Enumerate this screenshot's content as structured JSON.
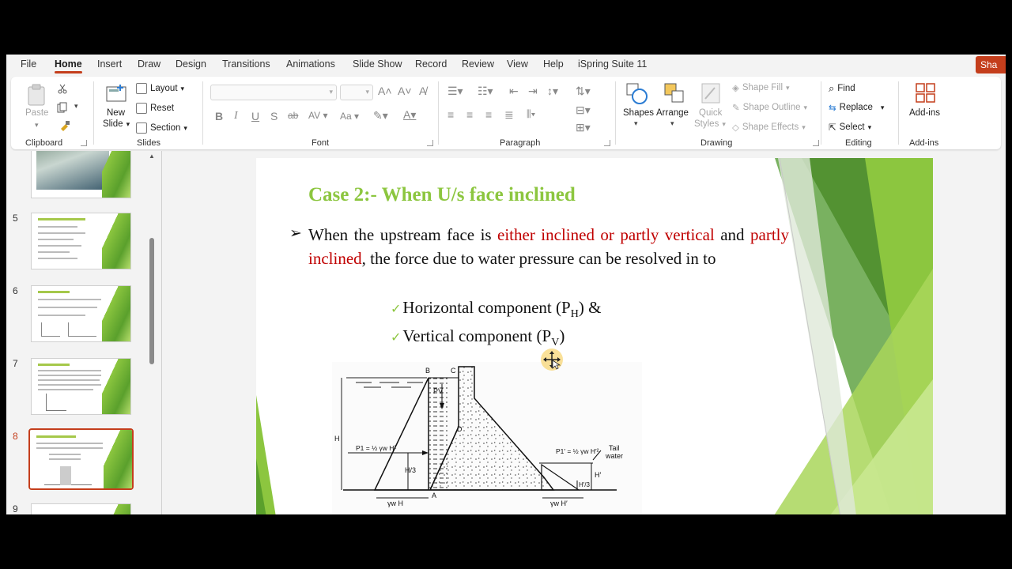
{
  "menu": {
    "tabs": [
      "File",
      "Home",
      "Insert",
      "Draw",
      "Design",
      "Transitions",
      "Animations",
      "Slide Show",
      "Record",
      "Review",
      "View",
      "Help",
      "iSpring Suite 11"
    ],
    "share_label": "Sha"
  },
  "ribbon": {
    "clipboard": {
      "paste": "Paste",
      "group": "Clipboard"
    },
    "slides": {
      "new_slide_1": "New",
      "new_slide_2": "Slide",
      "layout": "Layout",
      "reset": "Reset",
      "section": "Section",
      "group": "Slides"
    },
    "font": {
      "group": "Font",
      "aa": "Aa"
    },
    "paragraph": {
      "group": "Paragraph"
    },
    "drawing": {
      "shapes": "Shapes",
      "arrange": "Arrange",
      "quick_1": "Quick",
      "quick_2": "Styles",
      "shape_fill": "Shape Fill",
      "shape_outline": "Shape Outline",
      "shape_effects": "Shape Effects",
      "group": "Drawing"
    },
    "editing": {
      "find": "Find",
      "replace": "Replace",
      "select": "Select",
      "group": "Editing"
    },
    "addins": {
      "label": "Add-ins",
      "group": "Add-ins"
    }
  },
  "thumbnails": [
    {
      "num": "5"
    },
    {
      "num": "6"
    },
    {
      "num": "7"
    },
    {
      "num": "8"
    },
    {
      "num": "9"
    }
  ],
  "slide": {
    "title": "Case 2:- When U/s face inclined",
    "bullet_part1": "When the upstream face is ",
    "bullet_red1": "either inclined or partly vertical",
    "bullet_part2": " and ",
    "bullet_red2": "partly inclined",
    "bullet_part3": ", the force due to water pressure can be resolved in to",
    "sub1_text": "Horizontal component (P",
    "sub1_sub": "H",
    "sub1_tail": ") &",
    "sub2_text": "Vertical component (P",
    "sub2_sub": "V",
    "sub2_tail": ")"
  },
  "diagram": {
    "labels": {
      "b": "B",
      "c": "C",
      "pv": "PV",
      "d": "D",
      "h": "H",
      "p1": "P1 = ½ γw H²",
      "h3": "H/3",
      "a": "A",
      "gwh": "γw H",
      "p1p": "P1′ = ½ γw H′²",
      "tail": "Tail",
      "water": "water",
      "hp": "H′",
      "h3p": "H′/3",
      "gwhp": "γw H′"
    }
  }
}
